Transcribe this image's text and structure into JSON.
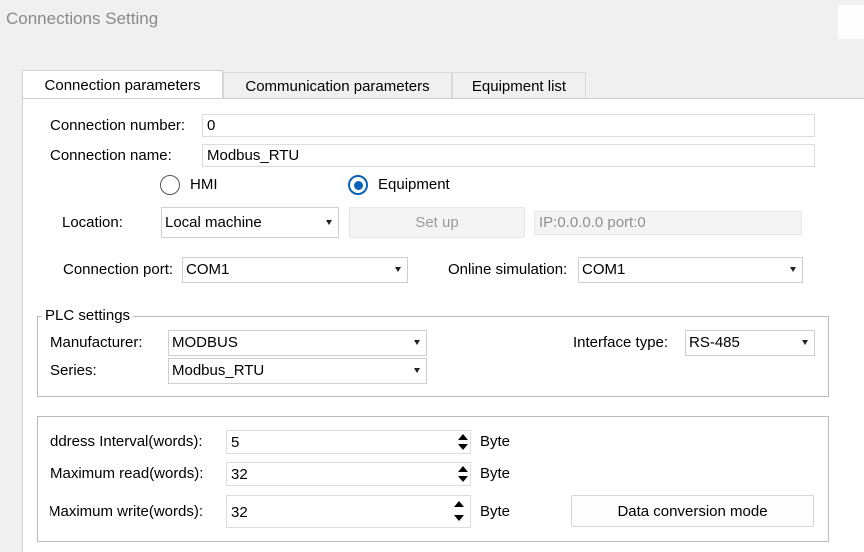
{
  "window": {
    "title": "Connections Setting"
  },
  "tabs": [
    {
      "label": "Connection parameters",
      "active": true
    },
    {
      "label": "Communication parameters",
      "active": false
    },
    {
      "label": "Equipment list",
      "active": false
    }
  ],
  "connection": {
    "number_label": "Connection number:",
    "number_value": "0",
    "name_label": "Connection name:",
    "name_value": "Modbus_RTU"
  },
  "type_radio": {
    "hmi_label": "HMI",
    "equipment_label": "Equipment",
    "selected": "Equipment"
  },
  "location": {
    "label": "Location:",
    "value": "Local machine",
    "setup_label": "Set up",
    "ip_text": "IP:0.0.0.0 port:0"
  },
  "ports": {
    "connection_port_label": "Connection port:",
    "connection_port_value": "COM1",
    "online_sim_label": "Online simulation:",
    "online_sim_value": "COM1"
  },
  "plc": {
    "group_title": "PLC settings",
    "manufacturer_label": "Manufacturer:",
    "manufacturer_value": "MODBUS",
    "series_label": "Series:",
    "series_value": "Modbus_RTU",
    "interface_label": "Interface type:",
    "interface_value": "RS-485"
  },
  "words": {
    "address_interval_label": "ddress Interval(words):",
    "address_interval_value": "5",
    "max_read_label": "Maximum read(words):",
    "max_read_value": "32",
    "max_write_label": "Maximum write(words):",
    "max_write_value": "32",
    "unit": "Byte",
    "data_conversion_label": "Data conversion mode"
  },
  "colors": {
    "accent": "#0a62b8",
    "background": "#f0f0f0",
    "panel": "#ffffff"
  }
}
